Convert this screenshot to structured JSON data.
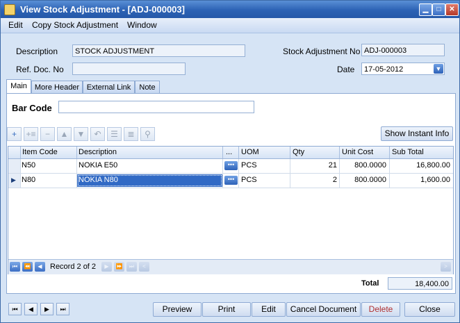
{
  "window": {
    "title": "View Stock Adjustment - [ADJ-000003]"
  },
  "menu": [
    "Edit",
    "Copy Stock Adjustment",
    "Window"
  ],
  "form": {
    "description_label": "Description",
    "description_value": "STOCK ADJUSTMENT",
    "refdoc_label": "Ref. Doc. No",
    "refdoc_value": "",
    "adjno_label": "Stock Adjustment No",
    "adjno_value": "ADJ-000003",
    "date_label": "Date",
    "date_value": "17-05-2012"
  },
  "tabs": [
    "Main",
    "More Header",
    "External Link",
    "Note"
  ],
  "barcode": {
    "label": "Bar Code",
    "value": ""
  },
  "show_instant_info": "Show Instant Info",
  "grid": {
    "columns": [
      "Item Code",
      "Description",
      "...",
      "UOM",
      "Qty",
      "Unit Cost",
      "Sub Total"
    ],
    "rows": [
      {
        "item_code": "N50",
        "description": "NOKIA E50",
        "uom": "PCS",
        "qty": "21",
        "unit_cost": "800.0000",
        "sub_total": "16,800.00"
      },
      {
        "item_code": "N80",
        "description": "NOKIA N80",
        "uom": "PCS",
        "qty": "2",
        "unit_cost": "800.0000",
        "sub_total": "1,600.00"
      }
    ],
    "record_label": "Record 2 of 2"
  },
  "total": {
    "label": "Total",
    "value": "18,400.00"
  },
  "buttons": {
    "preview": "Preview",
    "print": "Print",
    "edit": "Edit",
    "cancel_document": "Cancel Document",
    "delete": "Delete",
    "close": "Close"
  },
  "colors": {
    "title_bar": "#2c62b4",
    "selected_cell": "#316ac5",
    "delete_text": "#b03030"
  }
}
